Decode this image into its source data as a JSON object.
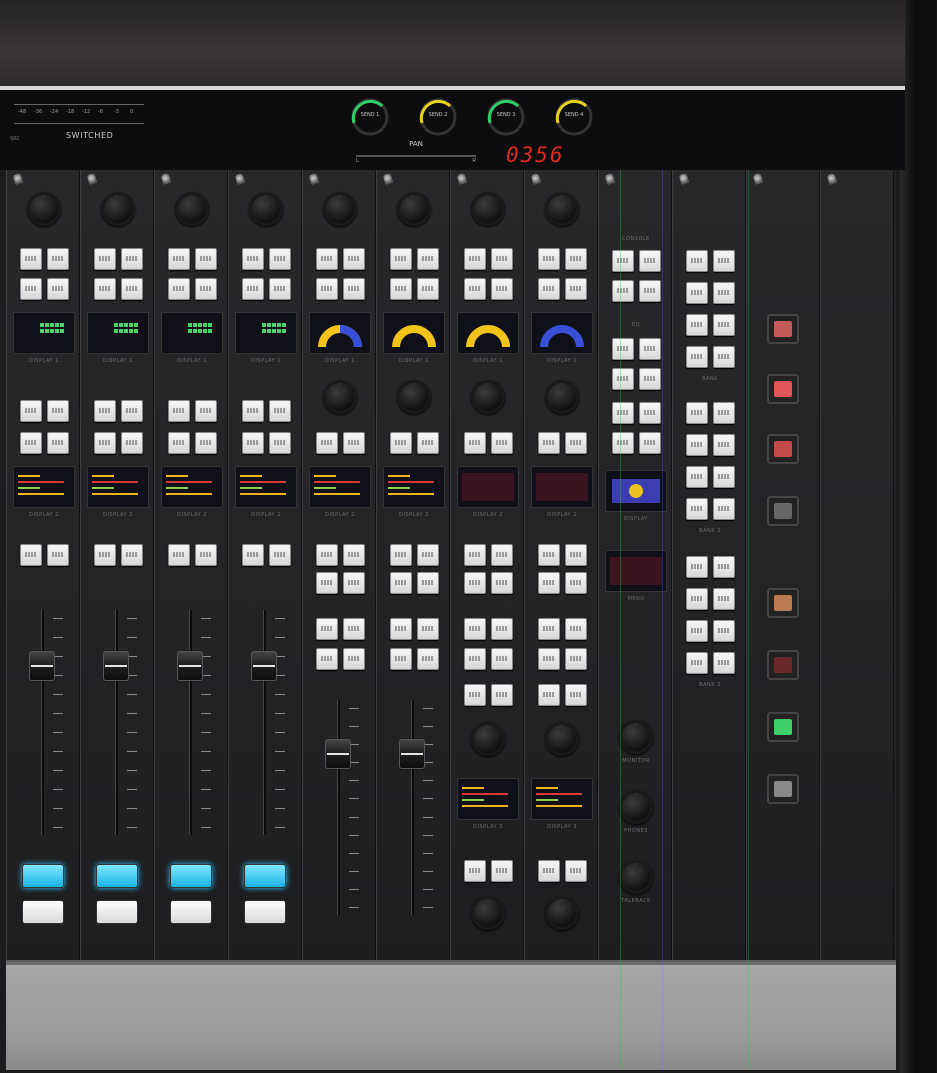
{
  "header": {
    "switched_label": "SWITCHED",
    "timecode": "0356",
    "pan_label": "PAN",
    "pan_left": "L",
    "pan_right": "R"
  },
  "sends": [
    {
      "label": "SEND 1",
      "arc_color": "#2fd06a"
    },
    {
      "label": "SEND 2",
      "arc_color": "#e8d21a"
    },
    {
      "label": "SEND 3",
      "arc_color": "#2fd06a"
    },
    {
      "label": "SEND 4",
      "arc_color": "#e8d21a"
    }
  ],
  "colors": {
    "cyan_button": "#29c9ff",
    "timecode_red": "#e0281f",
    "gauge_yellow": "#f2c41a",
    "gauge_blue": "#3a4fd8",
    "tile_green": "#3fcf6a"
  },
  "strips": [
    {
      "type": "fader",
      "screen1": "DISPLAY 1",
      "screen2": "DISPLAY 2",
      "gauge": "none",
      "cyan": true
    },
    {
      "type": "fader",
      "screen1": "DISPLAY 1",
      "screen2": "DISPLAY 2",
      "gauge": "none",
      "cyan": true
    },
    {
      "type": "fader",
      "screen1": "DISPLAY 1",
      "screen2": "DISPLAY 2",
      "gauge": "none",
      "cyan": true
    },
    {
      "type": "fader",
      "screen1": "DISPLAY 1",
      "screen2": "DISPLAY 2",
      "gauge": "none",
      "cyan": true
    },
    {
      "type": "short",
      "screen1": "DISPLAY 1",
      "screen2": "DISPLAY 2",
      "gauge": "blue-yellow"
    },
    {
      "type": "short",
      "screen1": "DISPLAY 1",
      "screen2": "DISPLAY 2",
      "gauge": "yellow"
    },
    {
      "type": "knobs",
      "screen1": "DISPLAY 1",
      "screen2": "DISPLAY 2",
      "screen3": "DISPLAY 3",
      "gauge": "yellow"
    },
    {
      "type": "knobs",
      "screen1": "DISPLAY 1",
      "screen2": "DISPLAY 2",
      "screen3": "DISPLAY 3",
      "gauge": "blue"
    },
    {
      "type": "utility",
      "labels": [
        "CONSOLE",
        "EQ",
        "DISPLAY",
        "MENU",
        "MONITOR",
        "PHONES",
        "TALKBACK"
      ]
    },
    {
      "type": "banks",
      "labels": [
        "BANK",
        "BANK 2",
        "BANK 3"
      ]
    },
    {
      "type": "icons",
      "tiles": [
        "tile-1",
        "tile-2",
        "tile-3",
        "tile-4",
        "tile-5",
        "tile-6",
        "tile-7",
        "tile-8"
      ]
    },
    {
      "type": "blank"
    }
  ],
  "scale_ticks": [
    "-48",
    "-36",
    "-24",
    "-18",
    "-12",
    "-6",
    "-3",
    "0"
  ]
}
